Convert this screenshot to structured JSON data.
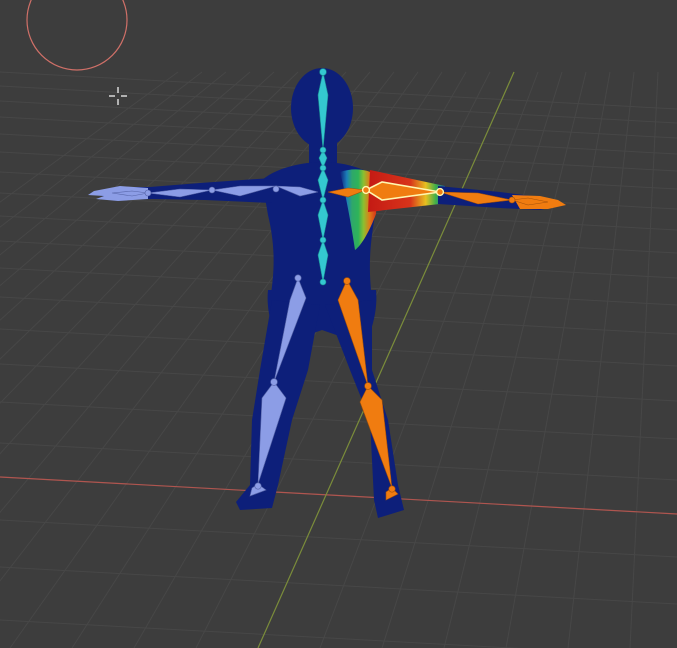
{
  "viewport": {
    "mode": "weight-paint",
    "background": "#3d3d3d",
    "grid_color": "#474747",
    "x_axis_color": "#b0554f",
    "y_axis_color": "#7a8c3a"
  },
  "brush": {
    "name": "brush-cursor-circle",
    "color": "#d07068"
  },
  "cursor": {
    "name": "crosshair-icon",
    "color": "#ffffff"
  },
  "mesh": {
    "name": "character-mesh",
    "zero_weight_color": "#0d1f7a"
  },
  "armature": {
    "spine_color": "#34c8d0",
    "left_side_color": "#8c9de6",
    "right_side_color": "#f07c10",
    "active_bone": "upper-arm-right",
    "active_outline": "#fff7b0"
  }
}
